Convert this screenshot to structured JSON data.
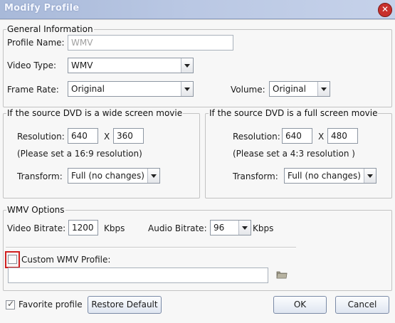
{
  "window": {
    "title": "Modify Profile",
    "close_glyph": "✕"
  },
  "general": {
    "legend": "General Information",
    "profile_name_label": "Profile Name:",
    "profile_name_value": "WMV",
    "video_type_label": "Video Type:",
    "video_type_value": "WMV",
    "frame_rate_label": "Frame Rate:",
    "frame_rate_value": "Original",
    "volume_label": "Volume:",
    "volume_value": "Original"
  },
  "wide": {
    "legend": "If the source DVD is a wide screen movie",
    "resolution_label": "Resolution:",
    "width": "640",
    "x_label": "X",
    "height": "360",
    "hint": "(Please set a 16:9 resolution)",
    "transform_label": "Transform:",
    "transform_value": "Full (no changes)"
  },
  "full": {
    "legend": "If the source DVD is a full screen movie",
    "resolution_label": "Resolution:",
    "width": "640",
    "x_label": "X",
    "height": "480",
    "hint": "(Please set a 4:3 resolution )",
    "transform_label": "Transform:",
    "transform_value": "Full (no changes)"
  },
  "wmv": {
    "legend": "WMV Options",
    "video_bitrate_label": "Video Bitrate:",
    "video_bitrate_value": "1200",
    "video_unit": "Kbps",
    "audio_bitrate_label": "Audio Bitrate:",
    "audio_bitrate_value": "96",
    "audio_unit": "Kbps",
    "custom_profile_label": "Custom WMV Profile:",
    "custom_profile_checked": false,
    "custom_profile_path": ""
  },
  "footer": {
    "favorite_label": "Favorite profile",
    "favorite_checked": true,
    "restore_label": "Restore Default",
    "ok_label": "OK",
    "cancel_label": "Cancel"
  },
  "icons": {
    "folder_icon": "folder-icon",
    "close_icon": "close-icon",
    "dropdown_icon": "chevron-down-icon",
    "checkmark_icon": "checkmark-icon"
  },
  "colors": {
    "titlebar": "#b9c7e3",
    "close_button": "#c8302c",
    "highlight": "#d02020"
  }
}
